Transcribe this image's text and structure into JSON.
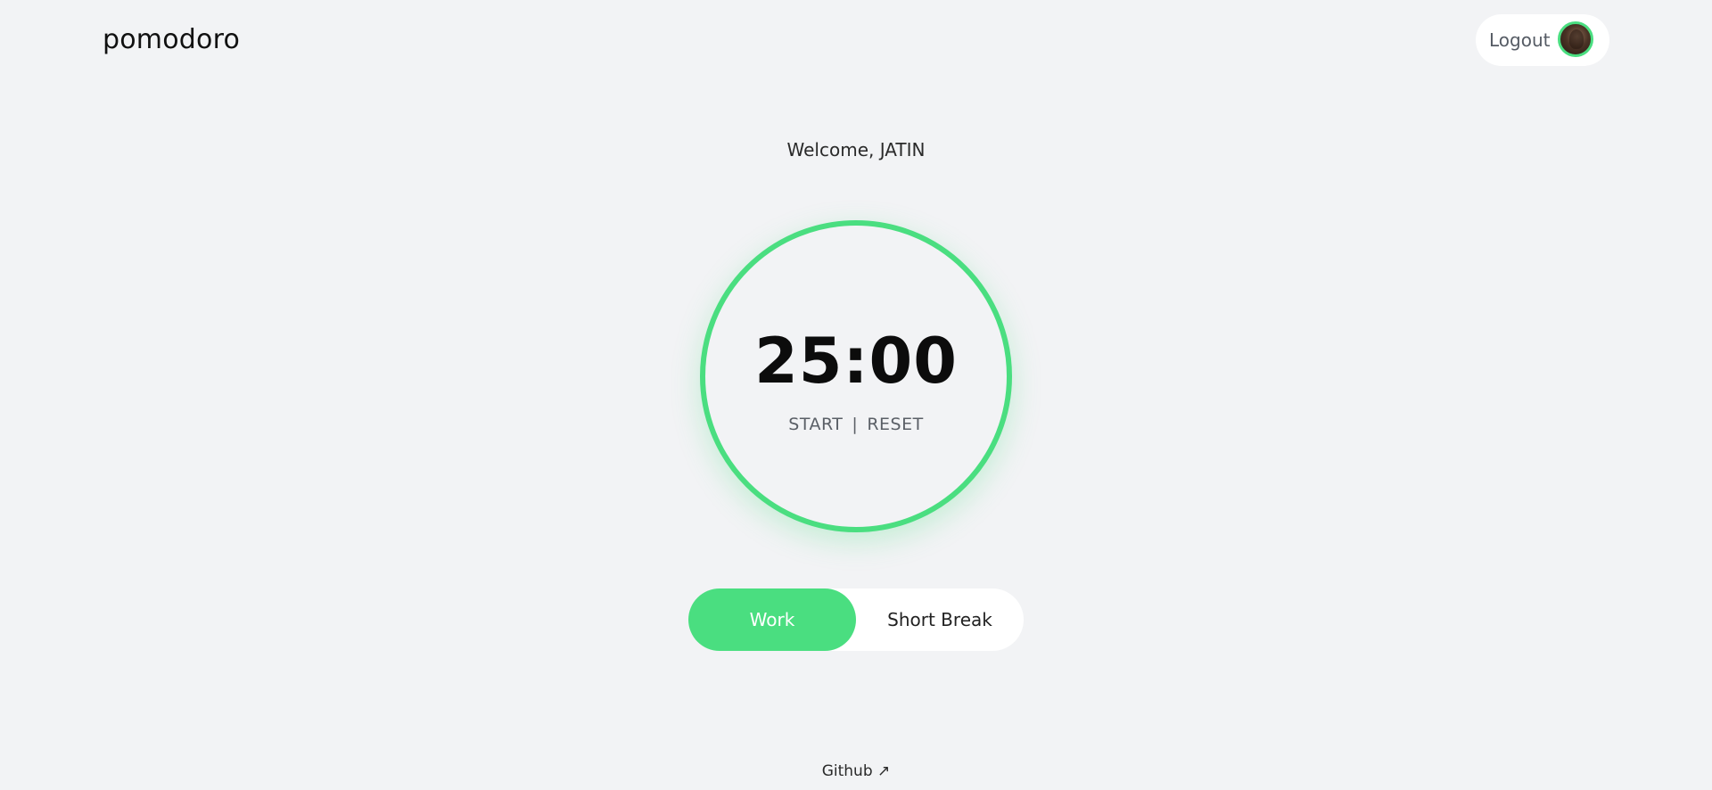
{
  "header": {
    "brand": "pomodoro",
    "logout_label": "Logout"
  },
  "welcome": "Welcome, JATIN",
  "timer": {
    "time": "25:00",
    "start_label": "START",
    "separator": "|",
    "reset_label": "RESET"
  },
  "modes": [
    {
      "label": "Work",
      "active": true
    },
    {
      "label": "Short Break",
      "active": false
    }
  ],
  "footer": {
    "github_label": "Github ↗"
  },
  "colors": {
    "accent": "#4ade80",
    "background": "#f2f3f5",
    "pill_background": "#ffffff"
  },
  "icons": {
    "avatar": "user-avatar-photo"
  }
}
